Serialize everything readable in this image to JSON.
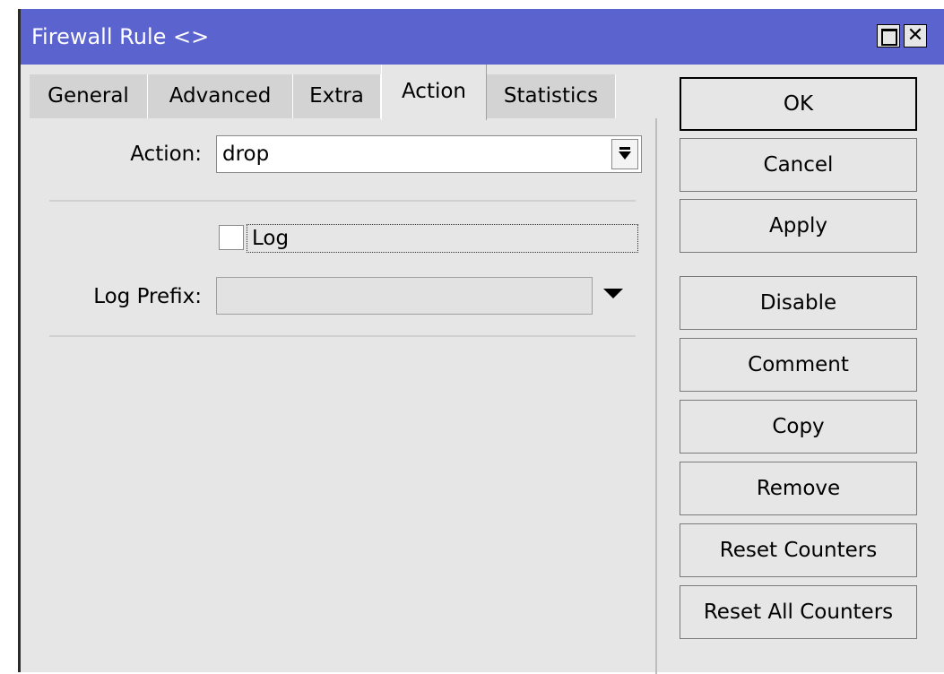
{
  "window": {
    "title": "Firewall Rule <>"
  },
  "tabs": [
    {
      "label": "General"
    },
    {
      "label": "Advanced"
    },
    {
      "label": "Extra"
    },
    {
      "label": "Action",
      "active": true
    },
    {
      "label": "Statistics"
    }
  ],
  "form": {
    "action_label": "Action:",
    "action_value": "drop",
    "log_label": "Log",
    "log_checked": false,
    "log_prefix_label": "Log Prefix:",
    "log_prefix_value": ""
  },
  "buttons": {
    "ok": "OK",
    "cancel": "Cancel",
    "apply": "Apply",
    "disable": "Disable",
    "comment": "Comment",
    "copy": "Copy",
    "remove": "Remove",
    "reset_counters": "Reset Counters",
    "reset_all_counters": "Reset All Counters"
  },
  "colors": {
    "titlebar": "#5b63cf",
    "panel": "#e6e6e6",
    "inactive_tab": "#d3d3d3"
  },
  "icons": {
    "maximize": "maximize-icon",
    "close": "close-icon",
    "dropdown": "dropdown-arrow-icon"
  }
}
